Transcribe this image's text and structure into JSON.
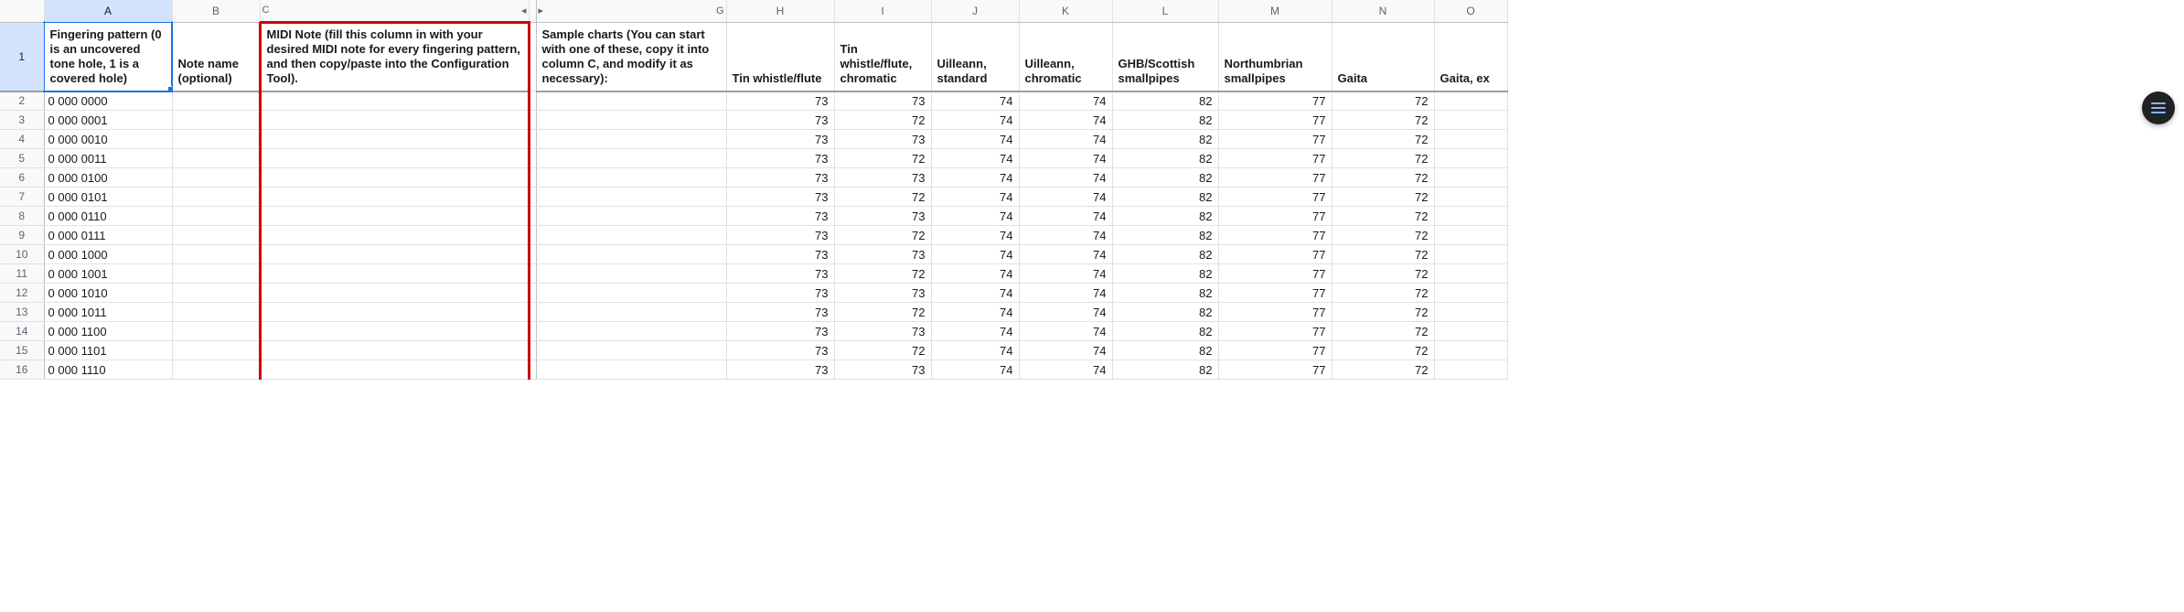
{
  "columns": {
    "A": "A",
    "B": "B",
    "C": "C",
    "G": "G",
    "H": "H",
    "I": "I",
    "J": "J",
    "K": "K",
    "L": "L",
    "M": "M",
    "N": "N",
    "O": "O"
  },
  "collapse_left": "◂",
  "collapse_right": "▸",
  "headers": {
    "A": "Fingering pattern (0 is an uncovered tone hole, 1 is a covered hole)",
    "B": "Note name (optional)",
    "C": "MIDI Note (fill this column in with your desired MIDI note for every fingering pattern, and then copy/paste into the Configuration Tool).",
    "G": "Sample charts (You can start with one of these, copy it into column C, and modify it as necessary):",
    "H": "Tin whistle/flute",
    "I": "Tin whistle/flute, chromatic",
    "J": "Uilleann, standard",
    "K": "Uilleann, chromatic",
    "L": "GHB/Scottish smallpipes",
    "M": "Northumbrian smallpipes",
    "N": "Gaita",
    "O": "Gaita, ex"
  },
  "rows": [
    {
      "n": "2",
      "A": "0 000 0000",
      "H": "73",
      "I": "73",
      "J": "74",
      "K": "74",
      "L": "82",
      "M": "77",
      "N": "72"
    },
    {
      "n": "3",
      "A": "0 000 0001",
      "H": "73",
      "I": "72",
      "J": "74",
      "K": "74",
      "L": "82",
      "M": "77",
      "N": "72"
    },
    {
      "n": "4",
      "A": "0 000 0010",
      "H": "73",
      "I": "73",
      "J": "74",
      "K": "74",
      "L": "82",
      "M": "77",
      "N": "72"
    },
    {
      "n": "5",
      "A": "0 000 0011",
      "H": "73",
      "I": "72",
      "J": "74",
      "K": "74",
      "L": "82",
      "M": "77",
      "N": "72"
    },
    {
      "n": "6",
      "A": "0 000 0100",
      "H": "73",
      "I": "73",
      "J": "74",
      "K": "74",
      "L": "82",
      "M": "77",
      "N": "72"
    },
    {
      "n": "7",
      "A": "0 000 0101",
      "H": "73",
      "I": "72",
      "J": "74",
      "K": "74",
      "L": "82",
      "M": "77",
      "N": "72"
    },
    {
      "n": "8",
      "A": "0 000 0110",
      "H": "73",
      "I": "73",
      "J": "74",
      "K": "74",
      "L": "82",
      "M": "77",
      "N": "72"
    },
    {
      "n": "9",
      "A": "0 000 0111",
      "H": "73",
      "I": "72",
      "J": "74",
      "K": "74",
      "L": "82",
      "M": "77",
      "N": "72"
    },
    {
      "n": "10",
      "A": "0 000 1000",
      "H": "73",
      "I": "73",
      "J": "74",
      "K": "74",
      "L": "82",
      "M": "77",
      "N": "72"
    },
    {
      "n": "11",
      "A": "0 000 1001",
      "H": "73",
      "I": "72",
      "J": "74",
      "K": "74",
      "L": "82",
      "M": "77",
      "N": "72"
    },
    {
      "n": "12",
      "A": "0 000 1010",
      "H": "73",
      "I": "73",
      "J": "74",
      "K": "74",
      "L": "82",
      "M": "77",
      "N": "72"
    },
    {
      "n": "13",
      "A": "0 000 1011",
      "H": "73",
      "I": "72",
      "J": "74",
      "K": "74",
      "L": "82",
      "M": "77",
      "N": "72"
    },
    {
      "n": "14",
      "A": "0 000 1100",
      "H": "73",
      "I": "73",
      "J": "74",
      "K": "74",
      "L": "82",
      "M": "77",
      "N": "72"
    },
    {
      "n": "15",
      "A": "0 000 1101",
      "H": "73",
      "I": "72",
      "J": "74",
      "K": "74",
      "L": "82",
      "M": "77",
      "N": "72"
    },
    {
      "n": "16",
      "A": "0 000 1110",
      "H": "73",
      "I": "73",
      "J": "74",
      "K": "74",
      "L": "82",
      "M": "77",
      "N": "72"
    }
  ],
  "header_row_label": "1"
}
